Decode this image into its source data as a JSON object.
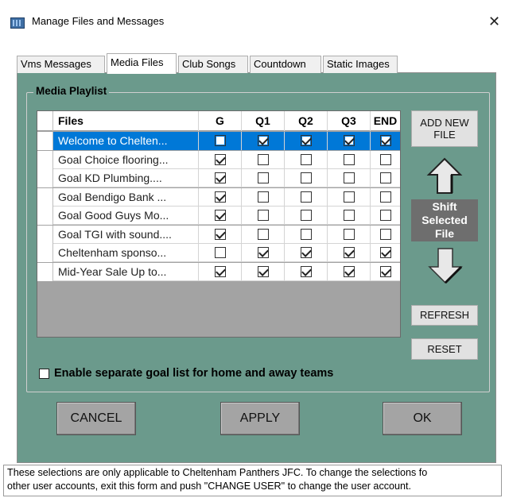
{
  "window": {
    "title": "Manage Files and Messages",
    "close_glyph": "✕"
  },
  "tabs": [
    {
      "label": "Vms Messages"
    },
    {
      "label": "Media Files"
    },
    {
      "label": "Club Songs"
    },
    {
      "label": "Countdown"
    },
    {
      "label": "Static Images"
    }
  ],
  "active_tab": "Media Files",
  "playlist": {
    "group_title": "Media Playlist",
    "columns": [
      "Files",
      "G",
      "Q1",
      "Q2",
      "Q3",
      "END"
    ],
    "rows": [
      {
        "file": "Welcome to Chelten...",
        "checks": [
          false,
          true,
          true,
          true,
          true
        ],
        "selected": true
      },
      {
        "file": "Goal Choice flooring...",
        "checks": [
          true,
          false,
          false,
          false,
          false
        ],
        "selected": false
      },
      {
        "file": "Goal KD Plumbing....",
        "checks": [
          true,
          false,
          false,
          false,
          false
        ],
        "selected": false
      },
      {
        "file": "Goal Bendigo Bank ...",
        "checks": [
          true,
          false,
          false,
          false,
          false
        ],
        "selected": false
      },
      {
        "file": "Goal Good Guys Mo...",
        "checks": [
          true,
          false,
          false,
          false,
          false
        ],
        "selected": false
      },
      {
        "file": "Goal TGI with sound....",
        "checks": [
          true,
          false,
          false,
          false,
          false
        ],
        "selected": false
      },
      {
        "file": "Cheltenham sponso...",
        "checks": [
          false,
          true,
          true,
          true,
          true
        ],
        "selected": false
      },
      {
        "file": "Mid-Year Sale Up to...",
        "checks": [
          true,
          true,
          true,
          true,
          true
        ],
        "selected": false
      }
    ]
  },
  "side": {
    "add_new_file": "ADD NEW FILE",
    "shift_label": "Shift Selected File",
    "shift_line1": "Shift",
    "shift_line2": "Selected",
    "shift_line3": "File",
    "up_icon": "arrow-up-icon",
    "down_icon": "arrow-down-icon",
    "refresh": "REFRESH",
    "reset": "RESET"
  },
  "options": {
    "separate_goal_list_label": "Enable separate goal list for home and away teams",
    "separate_goal_list_checked": false
  },
  "actions": {
    "cancel": "CANCEL",
    "apply": "APPLY",
    "ok": "OK"
  },
  "footer": {
    "line1": "These selections are only applicable to Cheltenham Panthers JFC. To change the selections fo",
    "line2": "other user accounts, exit this form and push \"CHANGE USER\" to change the user account."
  },
  "colors": {
    "panel_green": "#6b9a8c",
    "selection_blue": "#0078d7",
    "grid_empty": "#a3a3a3",
    "big_button_gray": "#a4a4a4"
  }
}
